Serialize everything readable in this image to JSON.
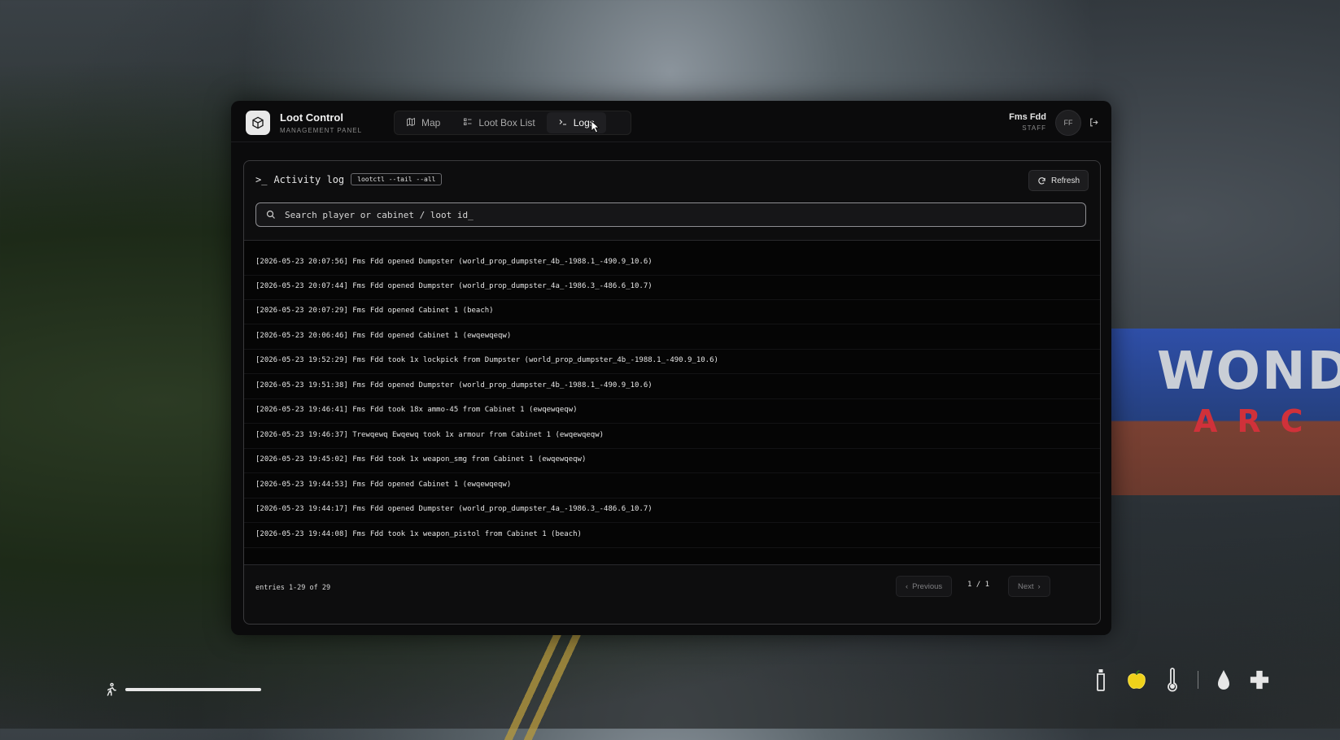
{
  "app": {
    "title": "Loot Control",
    "subtitle": "MANAGEMENT PANEL"
  },
  "tabs": [
    {
      "label": "Map",
      "icon": "map-icon"
    },
    {
      "label": "Loot Box List",
      "icon": "list-icon"
    },
    {
      "label": "Logs",
      "icon": "terminal-icon",
      "active": true
    }
  ],
  "user": {
    "name": "Fms Fdd",
    "role": "STAFF",
    "initials": "FF"
  },
  "activity": {
    "prompt": ">_",
    "title": "Activity log",
    "command": "lootctl --tail --all",
    "refresh_label": "Refresh"
  },
  "search": {
    "placeholder": "Search player or cabinet / loot id_"
  },
  "logs": [
    "[2026-05-23 20:07:56]  Fms Fdd opened Dumpster (world_prop_dumpster_4b_-1988.1_-490.9_10.6)",
    "[2026-05-23 20:07:44]  Fms Fdd opened Dumpster (world_prop_dumpster_4a_-1986.3_-486.6_10.7)",
    "[2026-05-23 20:07:29]  Fms Fdd opened Cabinet 1 (beach)",
    "[2026-05-23 20:06:46]  Fms Fdd opened Cabinet 1 (ewqewqeqw)",
    "[2026-05-23 19:52:29]  Fms Fdd took 1x lockpick from Dumpster (world_prop_dumpster_4b_-1988.1_-490.9_10.6)",
    "[2026-05-23 19:51:38]  Fms Fdd opened Dumpster (world_prop_dumpster_4b_-1988.1_-490.9_10.6)",
    "[2026-05-23 19:46:41]  Fms Fdd took 18x ammo-45 from Cabinet 1 (ewqewqeqw)",
    "[2026-05-23 19:46:37]  Trewqewq Ewqewq took 1x armour from Cabinet 1 (ewqewqeqw)",
    "[2026-05-23 19:45:02]  Fms Fdd took 1x weapon_smg from Cabinet 1 (ewqewqeqw)",
    "[2026-05-23 19:44:53]  Fms Fdd opened Cabinet 1 (ewqewqeqw)",
    "[2026-05-23 19:44:17]  Fms Fdd opened Dumpster (world_prop_dumpster_4a_-1986.3_-486.6_10.7)",
    "[2026-05-23 19:44:08]  Fms Fdd took 1x weapon_pistol from Cabinet 1 (beach)"
  ],
  "pagination": {
    "entries": "entries 1-29 of 29",
    "previous": "Previous",
    "page": "1 / 1",
    "next": "Next"
  },
  "background": {
    "sign_top": "WOND",
    "sign_bottom": "ARC"
  },
  "hud": {
    "stamina": 1.0,
    "icons": [
      "bottle-icon",
      "apple-icon",
      "thermometer-icon",
      "droplet-icon",
      "health-cross-icon"
    ]
  }
}
